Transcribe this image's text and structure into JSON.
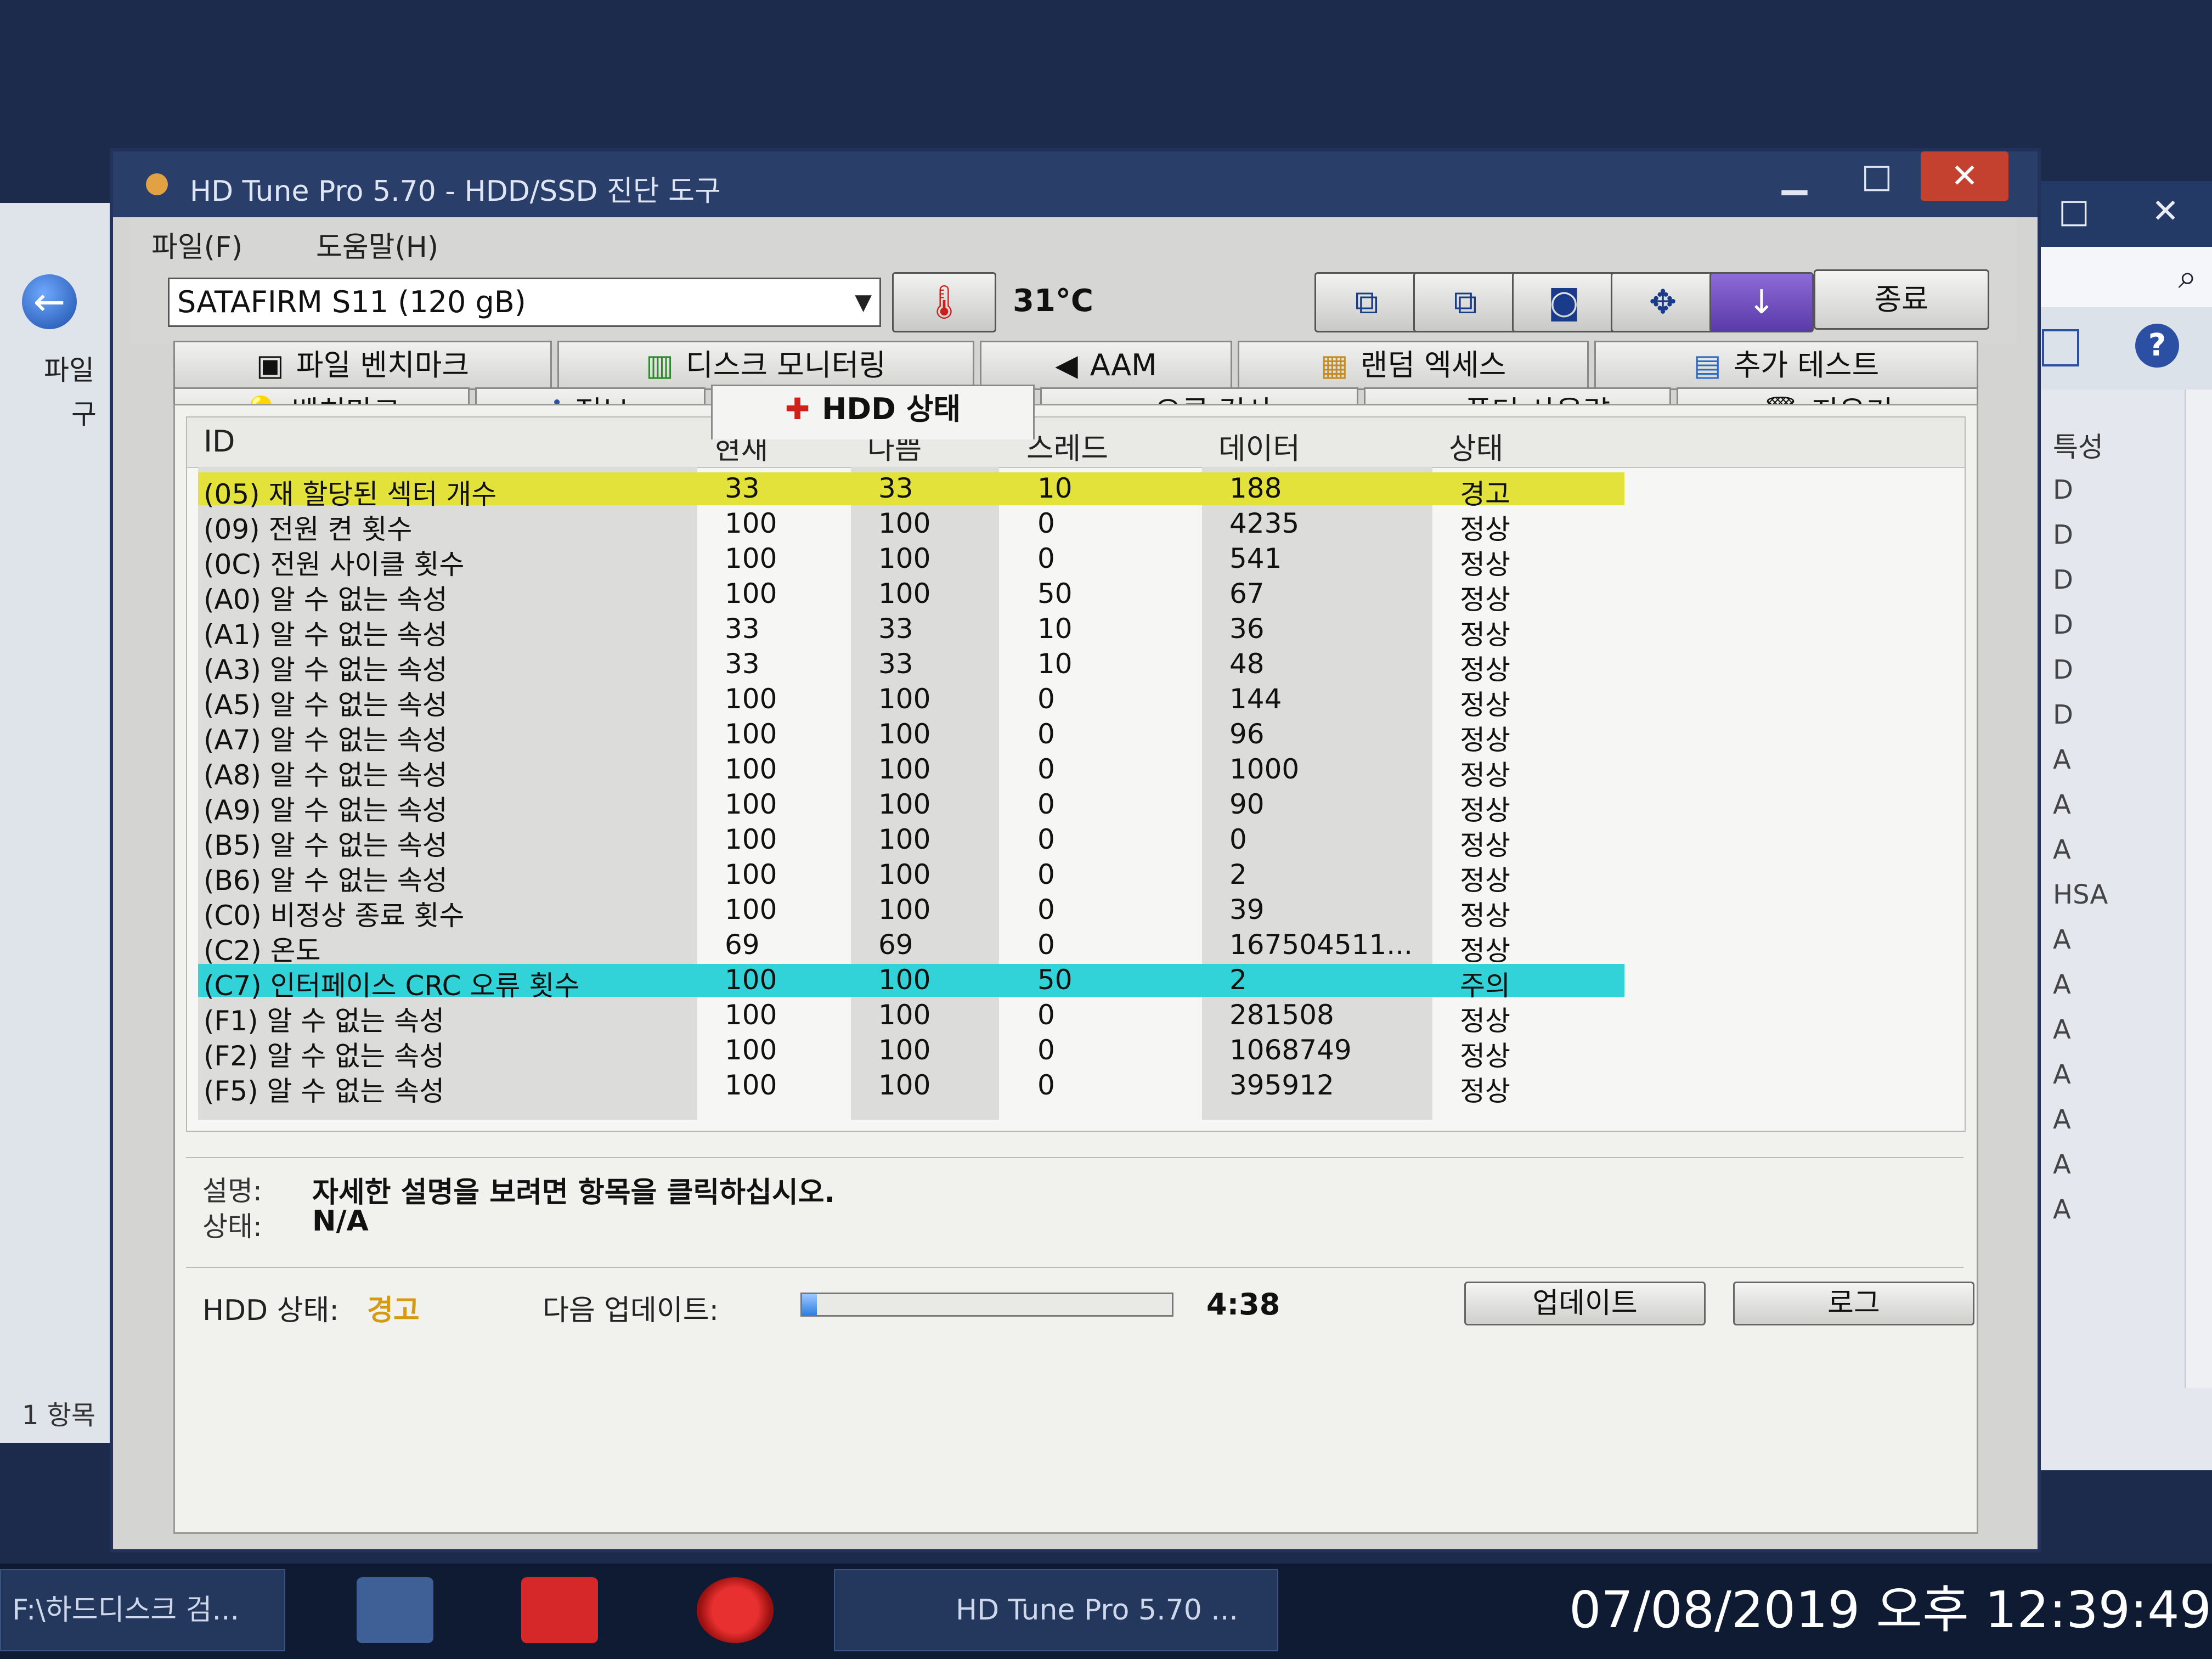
{
  "background_left": {
    "text1": "파일",
    "text2": "구",
    "text3": "1 항목"
  },
  "background_right": {
    "column_header": "특성",
    "attrs": [
      "D",
      "D",
      "D",
      "D",
      "D",
      "D",
      "A",
      "A",
      "A",
      "HSA",
      "A",
      "A",
      "A",
      "A",
      "A",
      "A",
      "A"
    ]
  },
  "window": {
    "title": "HD Tune Pro 5.70 - HDD/SSD 진단 도구"
  },
  "menu": {
    "file": "파일(F)",
    "help": "도움말(H)"
  },
  "toolbar": {
    "drive": "SATAFIRM   S11 (120 gB)",
    "temperature": "31°C",
    "exit": "종료"
  },
  "tabs": {
    "row1": [
      "파일 벤치마크",
      "디스크 모니터링",
      "AAM",
      "랜덤 엑세스",
      "추가 테스트"
    ],
    "row2": [
      "벤치마크",
      "정보",
      "HDD 상태",
      "오류 검사",
      "폴더 사용량",
      "지우기"
    ]
  },
  "table": {
    "headers": {
      "id": "ID",
      "current": "현재",
      "worst": "나쁨",
      "threshold": "스레드",
      "data": "데이터",
      "status": "상태"
    },
    "rows": [
      {
        "id": "(05) 재 할당된 섹터 개수",
        "cur": "33",
        "worst": "33",
        "thr": "10",
        "data": "188",
        "status": "경고"
      },
      {
        "id": "(09) 전원 켠 횟수",
        "cur": "100",
        "worst": "100",
        "thr": "0",
        "data": "4235",
        "status": "정상"
      },
      {
        "id": "(0C) 전원 사이클 횟수",
        "cur": "100",
        "worst": "100",
        "thr": "0",
        "data": "541",
        "status": "정상"
      },
      {
        "id": "(A0) 알 수 없는 속성",
        "cur": "100",
        "worst": "100",
        "thr": "50",
        "data": "67",
        "status": "정상"
      },
      {
        "id": "(A1) 알 수 없는 속성",
        "cur": "33",
        "worst": "33",
        "thr": "10",
        "data": "36",
        "status": "정상"
      },
      {
        "id": "(A3) 알 수 없는 속성",
        "cur": "33",
        "worst": "33",
        "thr": "10",
        "data": "48",
        "status": "정상"
      },
      {
        "id": "(A5) 알 수 없는 속성",
        "cur": "100",
        "worst": "100",
        "thr": "0",
        "data": "144",
        "status": "정상"
      },
      {
        "id": "(A7) 알 수 없는 속성",
        "cur": "100",
        "worst": "100",
        "thr": "0",
        "data": "96",
        "status": "정상"
      },
      {
        "id": "(A8) 알 수 없는 속성",
        "cur": "100",
        "worst": "100",
        "thr": "0",
        "data": "1000",
        "status": "정상"
      },
      {
        "id": "(A9) 알 수 없는 속성",
        "cur": "100",
        "worst": "100",
        "thr": "0",
        "data": "90",
        "status": "정상"
      },
      {
        "id": "(B5) 알 수 없는 속성",
        "cur": "100",
        "worst": "100",
        "thr": "0",
        "data": "0",
        "status": "정상"
      },
      {
        "id": "(B6) 알 수 없는 속성",
        "cur": "100",
        "worst": "100",
        "thr": "0",
        "data": "2",
        "status": "정상"
      },
      {
        "id": "(C0) 비정상 종료 횟수",
        "cur": "100",
        "worst": "100",
        "thr": "0",
        "data": "39",
        "status": "정상"
      },
      {
        "id": "(C2) 온도",
        "cur": "69",
        "worst": "69",
        "thr": "0",
        "data": "167504511...",
        "status": "정상"
      },
      {
        "id": "(C7) 인터페이스 CRC 오류 횟수",
        "cur": "100",
        "worst": "100",
        "thr": "50",
        "data": "2",
        "status": "주의"
      },
      {
        "id": "(F1) 알 수 없는 속성",
        "cur": "100",
        "worst": "100",
        "thr": "0",
        "data": "281508",
        "status": "정상"
      },
      {
        "id": "(F2) 알 수 없는 속성",
        "cur": "100",
        "worst": "100",
        "thr": "0",
        "data": "1068749",
        "status": "정상"
      },
      {
        "id": "(F5) 알 수 없는 속성",
        "cur": "100",
        "worst": "100",
        "thr": "0",
        "data": "395912",
        "status": "정상"
      }
    ]
  },
  "description": {
    "desc_label": "설명:",
    "desc_value": "자세한 설명을 보려면 항목을 클릭하십시오.",
    "status_label": "상태:",
    "status_value": "N/A"
  },
  "status": {
    "hdd_label": "HDD 상태:",
    "hdd_value": "경고",
    "next_update_label": "다음 업데이트:",
    "progress": 0.04,
    "countdown": "4:38",
    "update_button": "업데이트",
    "log_button": "로그"
  },
  "taskbar": {
    "explorer_item": "F:\\하드디스크 검...",
    "hdtune_item": "HD Tune Pro 5.70 ...",
    "datetime": "07/08/2019 오후 12:39:49"
  },
  "colors": {
    "warn_row": "#e3e23a",
    "caution_row": "#32d3d8",
    "warn_text": "#d69a12"
  }
}
